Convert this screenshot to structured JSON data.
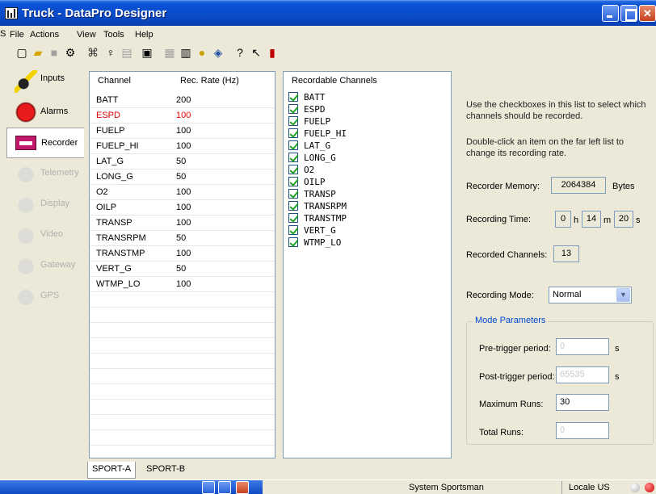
{
  "window": {
    "title": "Truck - DataPro Designer"
  },
  "menu": [
    "File",
    "Actions",
    "View",
    "Tools",
    "Help"
  ],
  "toolbar": {
    "icons": [
      "new-icon",
      "open-icon",
      "save-icon",
      "link-icon",
      "network-icon",
      "probe-icon",
      "tag-icon",
      "properties-icon",
      "chart-icon",
      "report-icon",
      "dbf-icon",
      "filter-icon",
      "help-icon",
      "context-help-icon",
      "ecu-icon"
    ]
  },
  "nav": {
    "items": [
      {
        "label": "Inputs",
        "state": "normal"
      },
      {
        "label": "Alarms",
        "state": "normal"
      },
      {
        "label": "Recorder",
        "state": "active"
      },
      {
        "label": "Telemetry",
        "state": "disabled"
      },
      {
        "label": "Display",
        "state": "disabled"
      },
      {
        "label": "Video",
        "state": "disabled"
      },
      {
        "label": "Gateway",
        "state": "disabled"
      },
      {
        "label": "GPS",
        "state": "disabled"
      }
    ]
  },
  "channels": {
    "headers": [
      "Channel",
      "Rec. Rate (Hz)"
    ],
    "rows": [
      {
        "name": "BATT",
        "rate": "200"
      },
      {
        "name": "ESPD",
        "rate": "100",
        "highlight": "#e00000"
      },
      {
        "name": "FUELP",
        "rate": "100"
      },
      {
        "name": "FUELP_HI",
        "rate": "100"
      },
      {
        "name": "LAT_G",
        "rate": "50"
      },
      {
        "name": "LONG_G",
        "rate": "50"
      },
      {
        "name": "O2",
        "rate": "100"
      },
      {
        "name": "OILP",
        "rate": "100"
      },
      {
        "name": "TRANSP",
        "rate": "100"
      },
      {
        "name": "TRANSRPM",
        "rate": "50"
      },
      {
        "name": "TRANSTMP",
        "rate": "100"
      },
      {
        "name": "VERT_G",
        "rate": "50"
      },
      {
        "name": "WTMP_LO",
        "rate": "100"
      }
    ]
  },
  "recordable": {
    "header": "Recordable Channels",
    "items": [
      "BATT",
      "ESPD",
      "FUELP",
      "FUELP_HI",
      "LAT_G",
      "LONG_G",
      "O2",
      "OILP",
      "TRANSP",
      "TRANSRPM",
      "TRANSTMP",
      "VERT_G",
      "WTMP_LO"
    ]
  },
  "info": {
    "text1": "Use the checkboxes in this list to select which channels should be recorded.",
    "text2": "Double-click an item on the far left list to change its recording rate."
  },
  "recorder": {
    "memory_label": "Recorder Memory:",
    "memory_value": "2064384",
    "memory_unit": "Bytes",
    "time_label": "Recording Time:",
    "time_h": "0",
    "time_h_unit": "h",
    "time_m": "14",
    "time_m_unit": "m",
    "time_s": "20",
    "time_s_unit": "s",
    "channels_label": "Recorded Channels:",
    "channels_value": "13",
    "mode_label": "Recording Mode:",
    "mode_value": "Normal"
  },
  "mode_params": {
    "title": "Mode Parameters",
    "pre_label": "Pre-trigger period:",
    "pre_value": "0",
    "pre_unit": "s",
    "post_label": "Post-trigger period:",
    "post_value": "65535",
    "post_unit": "s",
    "max_runs_label": "Maximum Runs:",
    "max_runs_value": "30",
    "total_runs_label": "Total Runs:",
    "total_runs_value": "0"
  },
  "tabs": [
    "SPORT-A",
    "SPORT-B"
  ],
  "statusbar": {
    "system": "System  Sportsman",
    "locale": "Locale  US"
  },
  "colors": {
    "accent": "#0a52d6",
    "highlight_row": "#e00000",
    "group_title": "#0046d5"
  }
}
